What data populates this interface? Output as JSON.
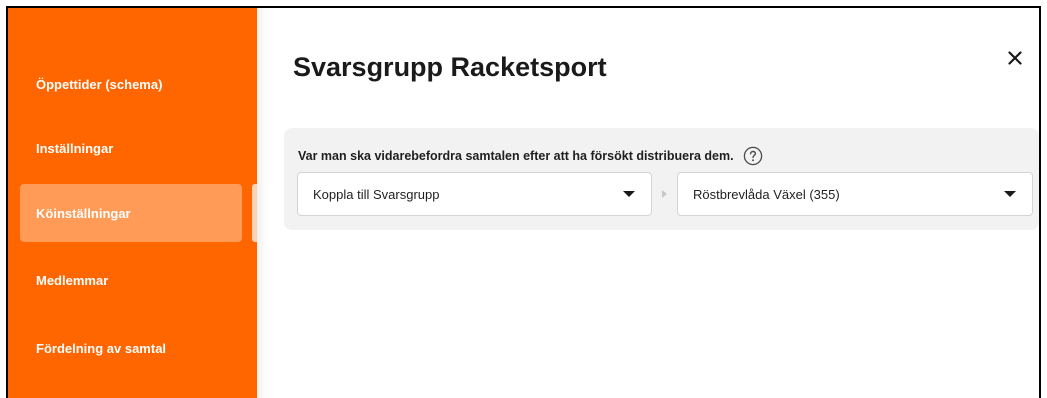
{
  "sidebar": {
    "items": [
      {
        "label": "Öppettider (schema)"
      },
      {
        "label": "Inställningar"
      },
      {
        "label": "Köinställningar"
      },
      {
        "label": "Medlemmar"
      },
      {
        "label": "Fördelning av samtal"
      }
    ],
    "active_index": 2
  },
  "dialog": {
    "title": "Svarsgrupp Racketsport",
    "close_icon": "close-icon"
  },
  "forwarding": {
    "question": "Var man ska vidarebefordra samtalen efter att ha försökt distribuera dem.",
    "help_icon": "help-icon",
    "action_select": {
      "value": "Koppla till Svarsgrupp"
    },
    "target_select": {
      "value": "Röstbrevlåda Växel (355)"
    }
  },
  "colors": {
    "sidebar": "#ff6600",
    "sidebar_active": "#ff9a57",
    "panel": "#f2f2f2"
  }
}
